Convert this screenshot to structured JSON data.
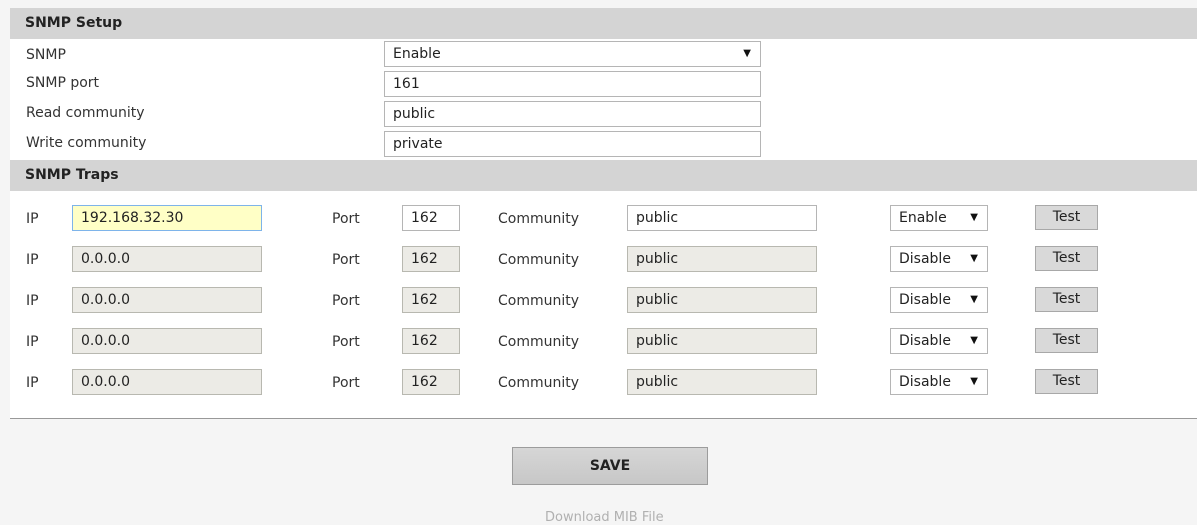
{
  "snmp_setup": {
    "title": "SNMP Setup",
    "snmp_label": "SNMP",
    "snmp_value": "Enable",
    "port_label": "SNMP port",
    "port_value": "161",
    "read_label": "Read community",
    "read_value": "public",
    "write_label": "Write community",
    "write_value": "private"
  },
  "snmp_traps": {
    "title": "SNMP Traps",
    "ip_label": "IP",
    "port_label": "Port",
    "community_label": "Community",
    "test_label": "Test",
    "rows": [
      {
        "ip": "192.168.32.30",
        "port": "162",
        "community": "public",
        "state": "Enable"
      },
      {
        "ip": "0.0.0.0",
        "port": "162",
        "community": "public",
        "state": "Disable"
      },
      {
        "ip": "0.0.0.0",
        "port": "162",
        "community": "public",
        "state": "Disable"
      },
      {
        "ip": "0.0.0.0",
        "port": "162",
        "community": "public",
        "state": "Disable"
      },
      {
        "ip": "0.0.0.0",
        "port": "162",
        "community": "public",
        "state": "Disable"
      }
    ]
  },
  "save_label": "SAVE",
  "download_label": "Download MIB File",
  "icons": {
    "dropdown": "chevron-down-icon"
  }
}
